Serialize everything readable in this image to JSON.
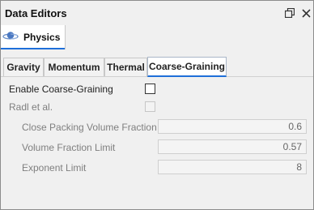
{
  "window": {
    "title": "Data Editors"
  },
  "panel_tab": {
    "label": "Physics",
    "icon": "planet-icon"
  },
  "tabs": [
    {
      "label": "Gravity",
      "active": false
    },
    {
      "label": "Momentum",
      "active": false
    },
    {
      "label": "Thermal",
      "active": false
    },
    {
      "label": "Coarse-Graining",
      "active": true
    }
  ],
  "form": {
    "enable_label": "Enable Coarse-Graining",
    "enable_checked": false,
    "radl_label": "Radl et al.",
    "radl_checked": false,
    "fields": [
      {
        "label": "Close Packing Volume Fraction",
        "value": "0.6"
      },
      {
        "label": "Volume Fraction Limit",
        "value": "0.57"
      },
      {
        "label": "Exponent Limit",
        "value": "8"
      }
    ]
  },
  "colors": {
    "accent": "#1e6fd9",
    "disabled_text": "#7f7f7f"
  }
}
